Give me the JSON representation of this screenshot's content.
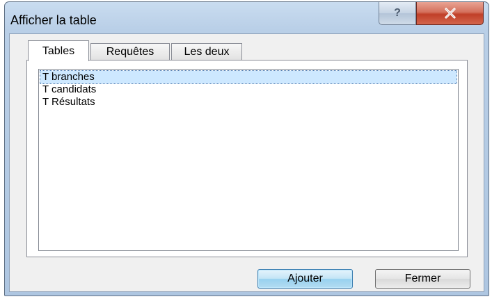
{
  "window": {
    "title": "Afficher la table",
    "help_label": "?"
  },
  "tabs": [
    {
      "label": "Tables",
      "active": true
    },
    {
      "label": "Requêtes",
      "active": false
    },
    {
      "label": "Les deux",
      "active": false
    }
  ],
  "list": {
    "items": [
      {
        "label": "T branches",
        "selected": true
      },
      {
        "label": "T candidats",
        "selected": false
      },
      {
        "label": "T Résultats",
        "selected": false
      }
    ]
  },
  "buttons": {
    "add_label": "Ajouter",
    "close_label": "Fermer"
  },
  "colors": {
    "title_bar": "#b9cfe7",
    "close_button": "#c03f28",
    "selection": "#cde8ff",
    "default_button": "#98d1ef"
  }
}
